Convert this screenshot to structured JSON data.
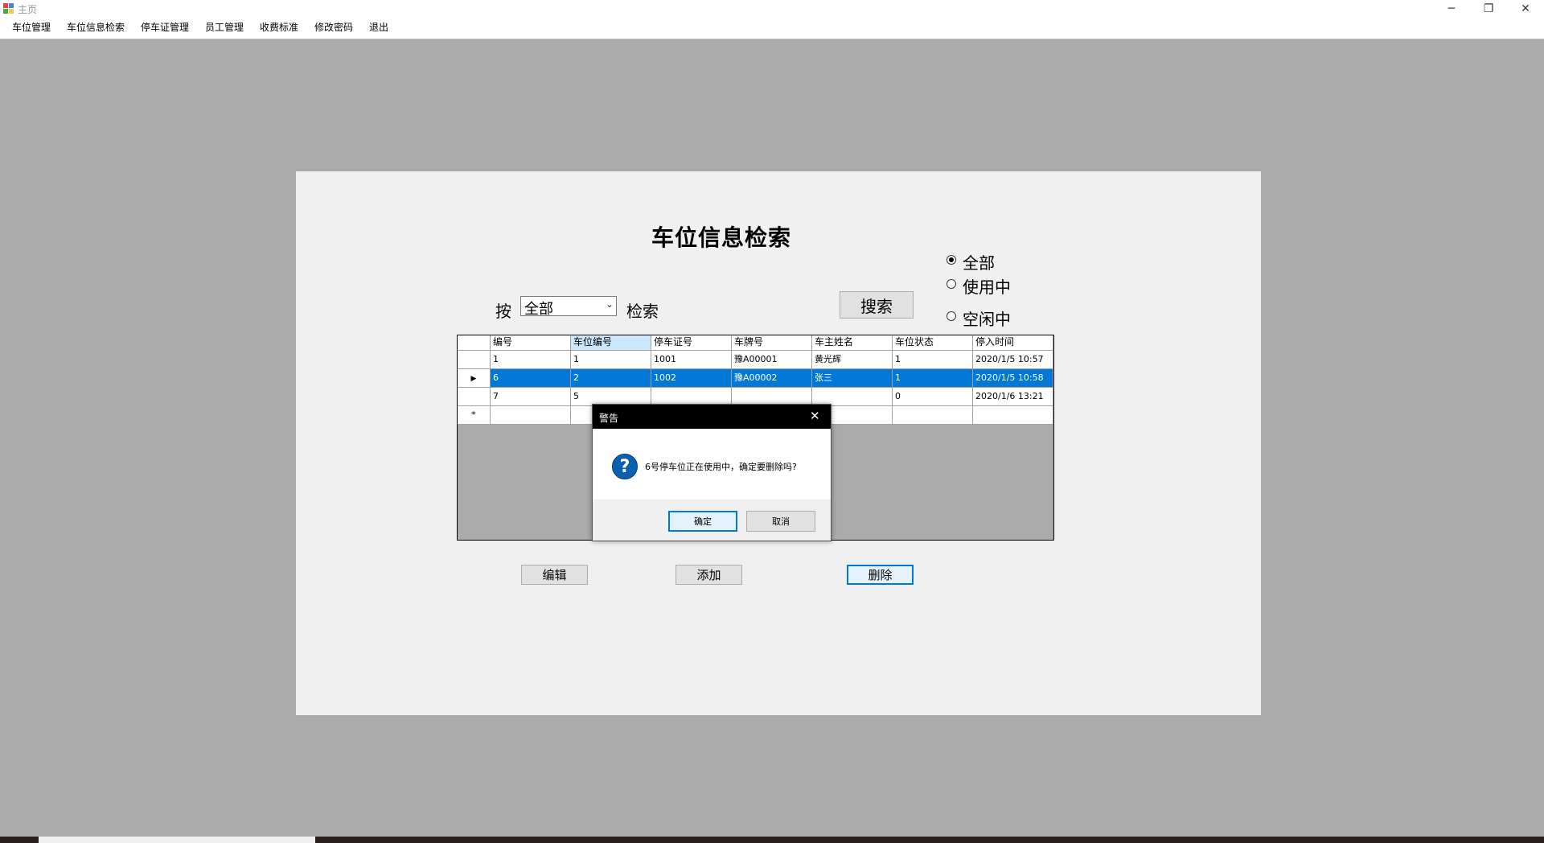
{
  "window": {
    "title": "主页"
  },
  "menu": [
    "车位管理",
    "车位信息检索",
    "停车证管理",
    "员工管理",
    "收费标准",
    "修改密码",
    "退出"
  ],
  "form": {
    "title": "车位信息检索",
    "by_label": "按",
    "search_label": "检索",
    "combo_value": "全部",
    "search_button": "搜索",
    "radios": [
      {
        "label": "全部",
        "checked": true
      },
      {
        "label": "使用中",
        "checked": false
      },
      {
        "label": "空闲中",
        "checked": false
      }
    ],
    "buttons": {
      "edit": "编辑",
      "add": "添加",
      "delete": "删除"
    }
  },
  "grid": {
    "columns": [
      "编号",
      "车位编号",
      "停车证号",
      "车牌号",
      "车主姓名",
      "车位状态",
      "停入时间"
    ],
    "rows": [
      [
        "1",
        "1",
        "1001",
        "豫A00001",
        "黄光辉",
        "1",
        "2020/1/5  10:57"
      ],
      [
        "6",
        "2",
        "1002",
        "豫A00002",
        "张三",
        "1",
        "2020/1/5  10:58"
      ],
      [
        "7",
        "5",
        "",
        "",
        "",
        "0",
        "2020/1/6  13:21"
      ]
    ],
    "selected_row": 1,
    "new_row_marker": "*"
  },
  "dialog": {
    "title": "警告",
    "message": "6号停车位正在使用中，确定要删除吗?",
    "ok": "确定",
    "cancel": "取消"
  },
  "colors": {
    "selection": "#0078d7",
    "column_header_highlight": "#cce8ff"
  }
}
